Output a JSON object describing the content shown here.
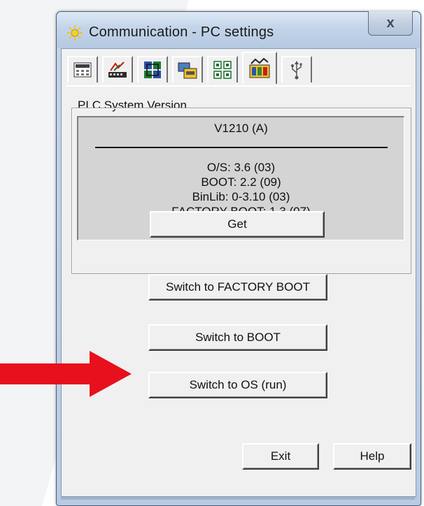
{
  "window": {
    "title": "Communication - PC settings",
    "close_label": "x"
  },
  "tabs": [
    {
      "icon": "keypad-icon"
    },
    {
      "icon": "network-settings-icon"
    },
    {
      "icon": "modules-icon"
    },
    {
      "icon": "connect-icon"
    },
    {
      "icon": "grid-modules-icon"
    },
    {
      "icon": "plc-version-icon",
      "active": true
    },
    {
      "icon": "usb-icon"
    }
  ],
  "plc_version": {
    "legend": "PLC System Version",
    "model": "V1210 (A)",
    "os": "O/S: 3.6 (03)",
    "boot": "BOOT: 2.2 (09)",
    "binlib": "BinLib: 0-3.10 (03)",
    "factory_boot": "FACTORY BOOT: 1.3 (07)",
    "get_label": "Get"
  },
  "actions": {
    "switch_factory_boot": "Switch to FACTORY BOOT",
    "switch_boot": "Switch to BOOT",
    "switch_os": "Switch to OS (run)",
    "exit": "Exit",
    "help": "Help"
  },
  "colors": {
    "arrow": "#e8101c",
    "panel": "#d4d4d4",
    "dialog_bg": "#f0f0f0"
  }
}
